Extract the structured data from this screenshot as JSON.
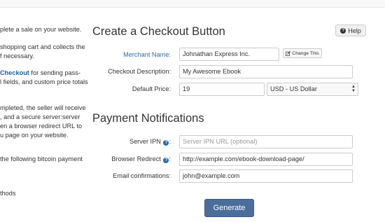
{
  "left_panel": {
    "lines": [
      "plete a sale on your website.",
      "shopping cart and collects the",
      "f necessary.",
      "Checkout",
      " for sending pass-",
      "l fields, and custom price totals",
      "mpleted, the seller will receive",
      ", and a secure server:server",
      "en a browser redirect URL to",
      "u page on your website.",
      " the following bitcoin payment",
      "thods"
    ]
  },
  "checkout": {
    "title": "Create a Checkout Button",
    "help_label": "Help",
    "merchant_label": "Merchant Name:",
    "merchant_value": "Johnathan Express Inc.",
    "change_label": "Change This",
    "description_label": "Checkout Description:",
    "description_value": "My Awesome Ebook",
    "price_label": "Default Price:",
    "price_value": "19",
    "currency_value": "USD - US Dollar"
  },
  "notifications": {
    "title": "Payment Notifications",
    "server_ipn_label": "Server IPN",
    "server_ipn_placeholder": "Server IPN URL (optional)",
    "browser_redirect_label": "Browser Redirect",
    "browser_redirect_value": "http://example.com/ebook-download-page/",
    "email_label": "Email confirmations:",
    "email_value": "john@example.com"
  },
  "actions": {
    "generate_label": "Generate"
  },
  "colors": {
    "accent": "#4a6d9a",
    "link": "#2a6aa8"
  }
}
